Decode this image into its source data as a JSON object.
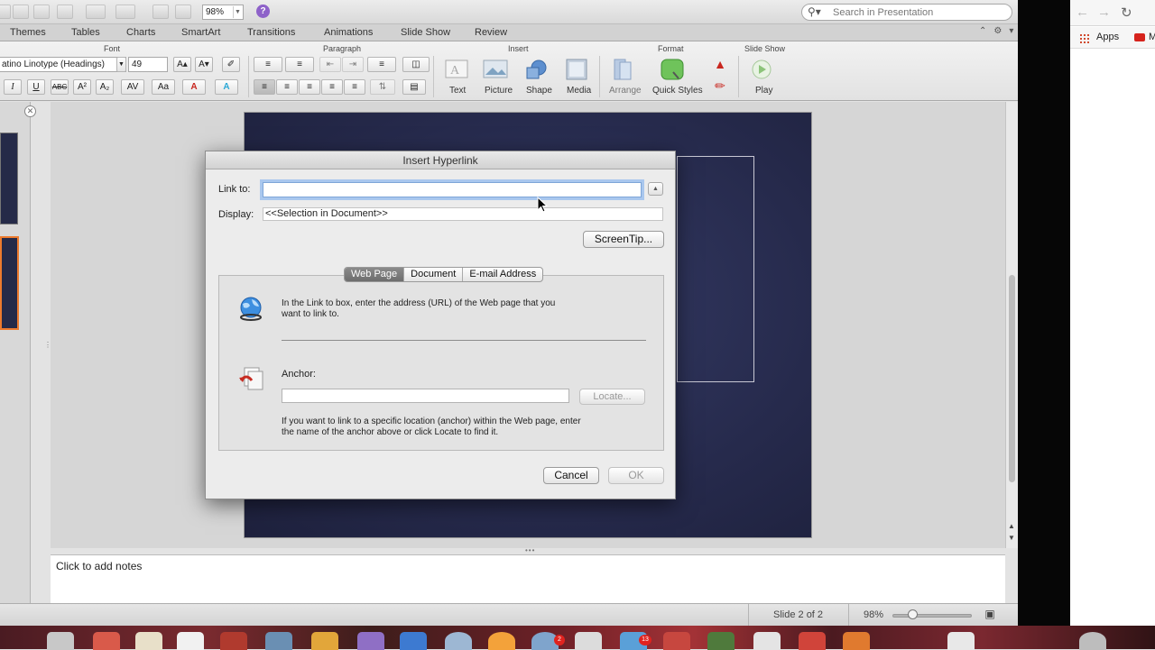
{
  "toolbar": {
    "zoom_value": "98%",
    "search_placeholder": "Search in Presentation"
  },
  "ribbon_tabs": [
    "Themes",
    "Tables",
    "Charts",
    "SmartArt",
    "Transitions",
    "Animations",
    "Slide Show",
    "Review"
  ],
  "ribbon": {
    "groups": {
      "font": "Font",
      "paragraph": "Paragraph",
      "insert": "Insert",
      "format": "Format",
      "slide_show": "Slide Show"
    },
    "font_name": "atino Linotype (Headings)",
    "font_size": "49",
    "format_buttons": {
      "italic": "I",
      "underline": "U",
      "strikethrough": "ABC"
    },
    "insert_buttons": [
      "Text",
      "Picture",
      "Shape",
      "Media"
    ],
    "format_group_buttons": [
      "Arrange",
      "Quick Styles"
    ],
    "slideshow_buttons": [
      "Play"
    ]
  },
  "notes": {
    "placeholder": "Click to add notes"
  },
  "status": {
    "slide_position": "Slide 2 of 2",
    "zoom": "98%"
  },
  "dialog": {
    "title": "Insert Hyperlink",
    "link_to_label": "Link to:",
    "link_to_value": "",
    "display_label": "Display:",
    "display_value": "<<Selection in Document>>",
    "screentip_button": "ScreenTip...",
    "tabs": [
      "Web Page",
      "Document",
      "E-mail Address"
    ],
    "active_tab": "Web Page",
    "web_page_info": "In the Link to box, enter the address (URL) of the Web page that you want to link to.",
    "anchor_label": "Anchor:",
    "anchor_value": "",
    "locate_button": "Locate...",
    "anchor_info": "If you want to link to a specific location (anchor) within the Web page, enter the name of the anchor above or click Locate to find it.",
    "cancel_button": "Cancel",
    "ok_button": "OK"
  },
  "browser": {
    "bookmark_apps": "Apps",
    "bookmark_partial": "M"
  },
  "dock": {
    "badges": [
      "2",
      "13"
    ]
  },
  "colors": {
    "slide_background": "#262a4c",
    "selected_thumbnail_border": "#ec7a2e",
    "focus_ring": "#a9c7ee",
    "active_segment": "#7a7a7a",
    "dock_badge": "#e0231f"
  },
  "icons": [
    "search-icon",
    "help-icon",
    "globe-icon",
    "anchor-document-icon",
    "apps-grid-icon",
    "youtube-icon",
    "play-icon",
    "shape-icon",
    "picture-icon",
    "media-icon",
    "text-box-icon",
    "quick-styles-icon",
    "arrange-icon"
  ]
}
